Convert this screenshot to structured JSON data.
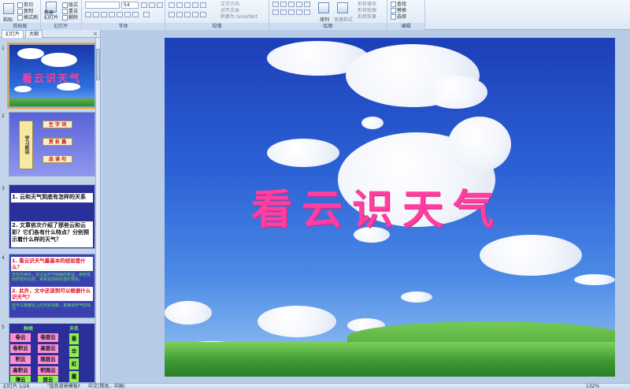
{
  "ribbon": {
    "groups": {
      "clipboard": "剪贴板",
      "slides": "幻灯片",
      "font": "字体",
      "paragraph": "段落",
      "drawing": "绘图",
      "editing": "编辑"
    },
    "paste": "粘贴",
    "cut": "剪切",
    "copy": "复制",
    "format_painter": "格式刷",
    "new_slide": "新建\n幻灯片",
    "layout": "版式",
    "reset": "重设",
    "delete": "删除",
    "font_size": "54",
    "text_direction": "文字方向",
    "align_text": "对齐文本",
    "smartart": "转换为 SmartArt",
    "arrange": "排列",
    "quick_styles": "快速样式",
    "shape_fill": "形状填充",
    "shape_outline": "形状轮廓",
    "shape_effects": "形状效果",
    "find": "查找",
    "replace": "替换",
    "select": "选择"
  },
  "left_pane": {
    "tabs": [
      "幻灯片",
      "大纲"
    ],
    "close": "×"
  },
  "slides": {
    "s1": {
      "num": "1",
      "title": "看云识天气"
    },
    "s2": {
      "num": "2",
      "title": "学习板块",
      "buttons": [
        "生 字 词",
        "赏 析 篇",
        "品 读 句"
      ]
    },
    "s3": {
      "num": "3",
      "q1": "1. 云和天气到底有怎样的关系",
      "q2": "2. 文章依次介绍了那些云和云彩？它们各有什么特点？分别预示着什么样的天气？"
    },
    "s4": {
      "num": "4",
      "q1": "1. 看云识天气最基本的经验是什么？",
      "a1": "天空的薄云，往往是天气晴朗的象征；那些低而厚密的云层，常常是阴雨风雪的预兆。",
      "q2": "2. 此外，文中还谈到可以根据什么识天气？",
      "a2": "还可以根据云上的光彩现象，来推测天气的情况"
    },
    "s5": {
      "num": "5",
      "h1": "种类",
      "h2": "天名",
      "col1": [
        "卷云",
        "卷积云",
        "积云",
        "高积云",
        "薄云"
      ],
      "col2": [
        "卷层云",
        "高层云",
        "雨层云",
        "积雨云",
        "层云"
      ],
      "col3": [
        "晕",
        "华",
        "虹",
        "霞"
      ]
    }
  },
  "main_slide": {
    "title": "看云识天气"
  },
  "status": {
    "slide_counter": "幻灯片 1/26",
    "theme": "\"蓝色背景模板\"",
    "language": "中文(简体，中国)",
    "zoom": "132%"
  },
  "colors": {
    "title_pink": "#ff3ea0",
    "sky_blue": "#2c62d6",
    "selection_orange": "#f0a030"
  }
}
